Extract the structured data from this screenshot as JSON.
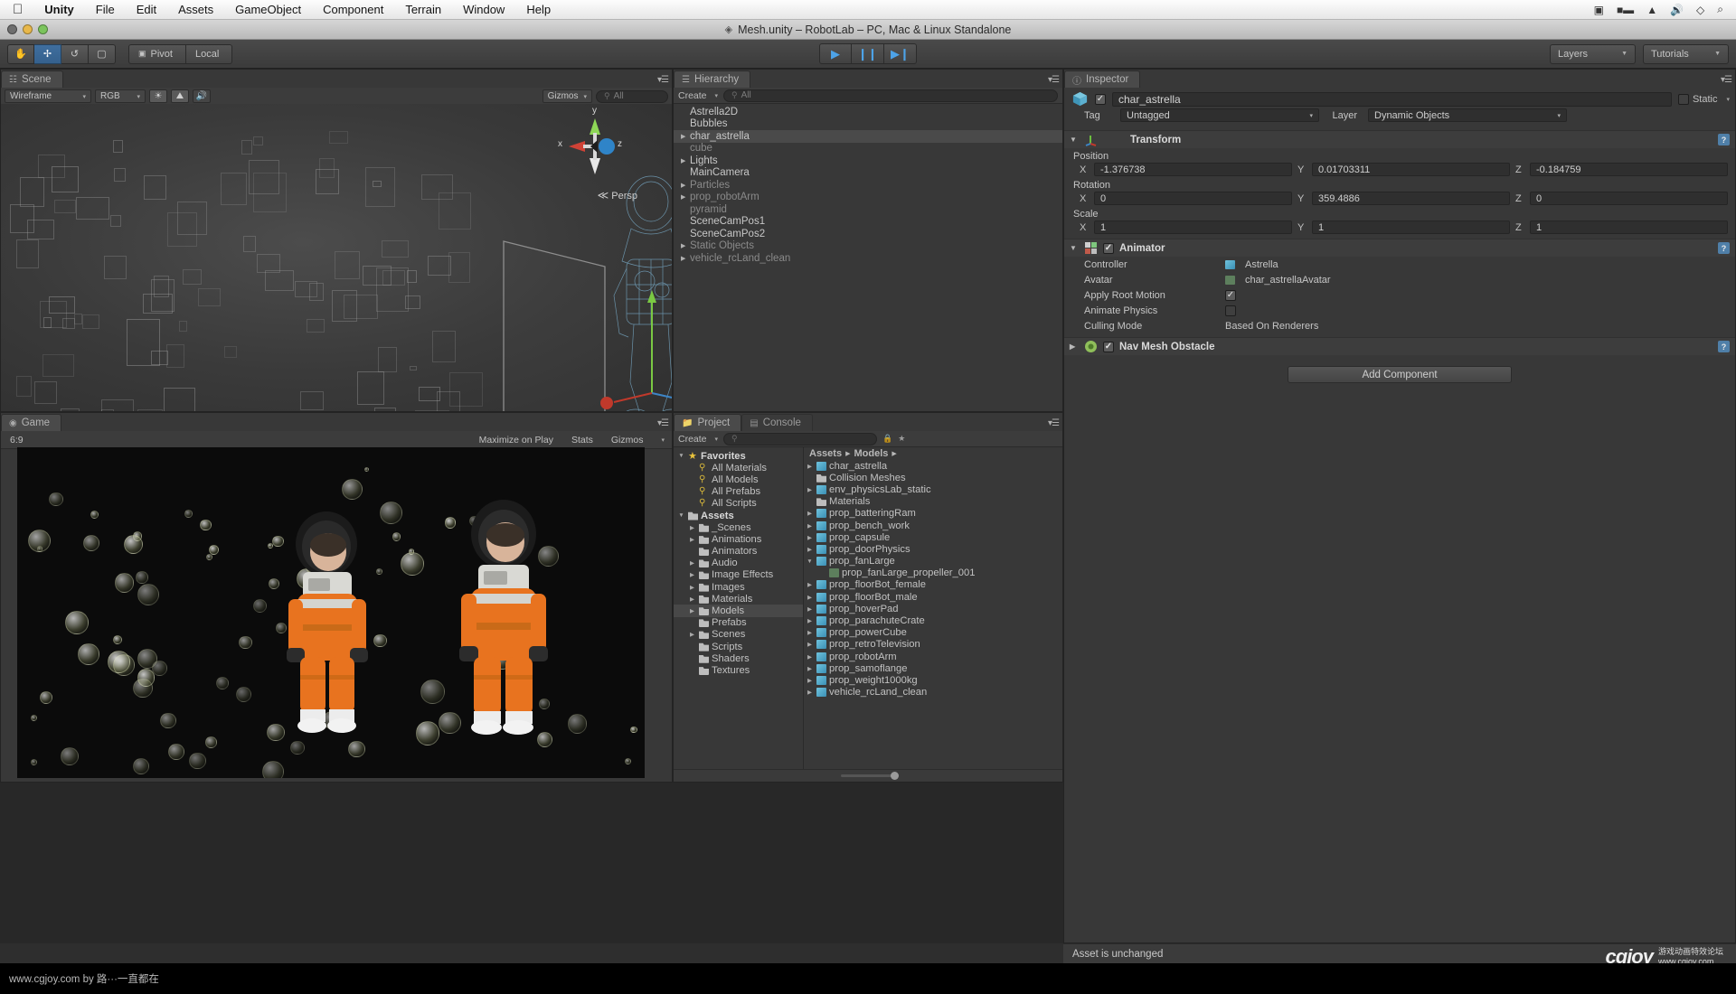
{
  "os_menu": {
    "apple_icon": "apple-icon",
    "items": [
      "Unity",
      "File",
      "Edit",
      "Assets",
      "GameObject",
      "Component",
      "Terrain",
      "Window",
      "Help"
    ],
    "status_icons": [
      "screen-record-icon",
      "battery-icon",
      "wifi-icon",
      "volume-icon",
      "bluetooth-icon",
      "search-icon"
    ]
  },
  "window": {
    "title": "Mesh.unity – RobotLab – PC, Mac & Linux Standalone",
    "title_icon": "unity-icon"
  },
  "toolbar": {
    "tools": [
      "hand-tool",
      "move-tool",
      "rotate-tool",
      "scale-tool"
    ],
    "active_tool_index": 1,
    "pivot_label": "Pivot",
    "space_label": "Local",
    "play_buttons": [
      "play-icon",
      "pause-icon",
      "step-icon"
    ],
    "layers_label": "Layers",
    "layout_label": "Tutorials"
  },
  "scene": {
    "tab_label": "Scene",
    "draw_mode": "Wireframe",
    "color_mode": "RGB",
    "toggles": [
      "lighting-icon",
      "skybox-icon",
      "audio-icon"
    ],
    "gizmos_label": "Gizmos",
    "search_placeholder": "All",
    "axis_labels": {
      "x": "x",
      "y": "y",
      "z": "z"
    },
    "projection": "Persp"
  },
  "game": {
    "tab_label": "Game",
    "aspect": "6:9",
    "maximize_label": "Maximize on Play",
    "stats_label": "Stats",
    "gizmos_label": "Gizmos"
  },
  "hierarchy": {
    "tab_label": "Hierarchy",
    "create_label": "Create",
    "search_placeholder": "All",
    "items": [
      {
        "label": "Astrella2D",
        "expandable": false,
        "selected": false,
        "dim": false
      },
      {
        "label": "Bubbles",
        "expandable": false,
        "selected": false,
        "dim": false
      },
      {
        "label": "char_astrella",
        "expandable": true,
        "selected": true,
        "dim": false
      },
      {
        "label": "cube",
        "expandable": false,
        "selected": false,
        "dim": true
      },
      {
        "label": "Lights",
        "expandable": true,
        "selected": false,
        "dim": false
      },
      {
        "label": "MainCamera",
        "expandable": false,
        "selected": false,
        "dim": false
      },
      {
        "label": "Particles",
        "expandable": true,
        "selected": false,
        "dim": true
      },
      {
        "label": "prop_robotArm",
        "expandable": true,
        "selected": false,
        "dim": true
      },
      {
        "label": "pyramid",
        "expandable": false,
        "selected": false,
        "dim": true
      },
      {
        "label": "SceneCamPos1",
        "expandable": false,
        "selected": false,
        "dim": false
      },
      {
        "label": "SceneCamPos2",
        "expandable": false,
        "selected": false,
        "dim": false
      },
      {
        "label": "Static Objects",
        "expandable": true,
        "selected": false,
        "dim": true
      },
      {
        "label": "vehicle_rcLand_clean",
        "expandable": true,
        "selected": false,
        "dim": true
      }
    ]
  },
  "inspector": {
    "tab_label": "Inspector",
    "object_name": "char_astrella",
    "object_enabled": true,
    "static_label": "Static",
    "tag_label": "Tag",
    "tag_value": "Untagged",
    "layer_label": "Layer",
    "layer_value": "Dynamic Objects",
    "transform": {
      "title": "Transform",
      "position_label": "Position",
      "rotation_label": "Rotation",
      "scale_label": "Scale",
      "position": {
        "x": "-1.376738",
        "y": "0.01703311",
        "z": "-0.184759"
      },
      "rotation": {
        "x": "0",
        "y": "359.4886",
        "z": "0"
      },
      "scale": {
        "x": "1",
        "y": "1",
        "z": "1"
      },
      "axis": {
        "x": "X",
        "y": "Y",
        "z": "Z"
      }
    },
    "animator": {
      "title": "Animator",
      "enabled": true,
      "rows": [
        {
          "label": "Controller",
          "value": "Astrella",
          "icon": "controller-icon",
          "type": "object"
        },
        {
          "label": "Avatar",
          "value": "char_astrellaAvatar",
          "icon": "avatar-icon",
          "type": "object"
        },
        {
          "label": "Apply Root Motion",
          "value": "",
          "type": "checkbox",
          "checked": true
        },
        {
          "label": "Animate Physics",
          "value": "",
          "type": "checkbox",
          "checked": false
        },
        {
          "label": "Culling Mode",
          "value": "Based On Renderers",
          "type": "enum"
        }
      ]
    },
    "nav_mesh_obstacle": {
      "title": "Nav Mesh Obstacle",
      "enabled": true
    },
    "add_component_label": "Add Component"
  },
  "project": {
    "tab_label": "Project",
    "console_tab_label": "Console",
    "create_label": "Create",
    "search_placeholder": "",
    "tree": [
      {
        "label": "Favorites",
        "icon": "star-icon",
        "indent": 0,
        "arrow": "down",
        "selected": false
      },
      {
        "label": "All Materials",
        "icon": "search-icon",
        "indent": 1,
        "arrow": "none",
        "selected": false
      },
      {
        "label": "All Models",
        "icon": "search-icon",
        "indent": 1,
        "arrow": "none",
        "selected": false
      },
      {
        "label": "All Prefabs",
        "icon": "search-icon",
        "indent": 1,
        "arrow": "none",
        "selected": false
      },
      {
        "label": "All Scripts",
        "icon": "search-icon",
        "indent": 1,
        "arrow": "none",
        "selected": false
      },
      {
        "label": "Assets",
        "icon": "folder-icon",
        "indent": 0,
        "arrow": "down",
        "selected": false
      },
      {
        "label": "_Scenes",
        "icon": "folder-icon",
        "indent": 1,
        "arrow": "right",
        "selected": false
      },
      {
        "label": "Animations",
        "icon": "folder-icon",
        "indent": 1,
        "arrow": "right",
        "selected": false
      },
      {
        "label": "Animators",
        "icon": "folder-icon",
        "indent": 1,
        "arrow": "none",
        "selected": false
      },
      {
        "label": "Audio",
        "icon": "folder-icon",
        "indent": 1,
        "arrow": "right",
        "selected": false
      },
      {
        "label": "Image Effects",
        "icon": "folder-icon",
        "indent": 1,
        "arrow": "right",
        "selected": false
      },
      {
        "label": "Images",
        "icon": "folder-icon",
        "indent": 1,
        "arrow": "right",
        "selected": false
      },
      {
        "label": "Materials",
        "icon": "folder-icon",
        "indent": 1,
        "arrow": "right",
        "selected": false
      },
      {
        "label": "Models",
        "icon": "folder-icon",
        "indent": 1,
        "arrow": "right",
        "selected": true
      },
      {
        "label": "Prefabs",
        "icon": "folder-icon",
        "indent": 1,
        "arrow": "none",
        "selected": false
      },
      {
        "label": "Scenes",
        "icon": "folder-icon",
        "indent": 1,
        "arrow": "right",
        "selected": false
      },
      {
        "label": "Scripts",
        "icon": "folder-icon",
        "indent": 1,
        "arrow": "none",
        "selected": false
      },
      {
        "label": "Shaders",
        "icon": "folder-icon",
        "indent": 1,
        "arrow": "none",
        "selected": false
      },
      {
        "label": "Textures",
        "icon": "folder-icon",
        "indent": 1,
        "arrow": "none",
        "selected": false
      }
    ],
    "breadcrumb": [
      "Assets",
      "Models"
    ],
    "assets": [
      {
        "label": "char_astrella",
        "icon": "mesh-icon",
        "indent": 0,
        "arrow": "right"
      },
      {
        "label": "Collision Meshes",
        "icon": "folder-icon",
        "indent": 0,
        "arrow": "none"
      },
      {
        "label": "env_physicsLab_static",
        "icon": "mesh-icon",
        "indent": 0,
        "arrow": "right"
      },
      {
        "label": "Materials",
        "icon": "folder-icon",
        "indent": 0,
        "arrow": "none"
      },
      {
        "label": "prop_batteringRam",
        "icon": "mesh-icon",
        "indent": 0,
        "arrow": "right"
      },
      {
        "label": "prop_bench_work",
        "icon": "mesh-icon",
        "indent": 0,
        "arrow": "right"
      },
      {
        "label": "prop_capsule",
        "icon": "mesh-icon",
        "indent": 0,
        "arrow": "right"
      },
      {
        "label": "prop_doorPhysics",
        "icon": "mesh-icon",
        "indent": 0,
        "arrow": "right"
      },
      {
        "label": "prop_fanLarge",
        "icon": "mesh-icon",
        "indent": 0,
        "arrow": "down"
      },
      {
        "label": "prop_fanLarge_propeller_001",
        "icon": "grid-icon",
        "indent": 1,
        "arrow": "none"
      },
      {
        "label": "prop_floorBot_female",
        "icon": "mesh-icon",
        "indent": 0,
        "arrow": "right"
      },
      {
        "label": "prop_floorBot_male",
        "icon": "mesh-icon",
        "indent": 0,
        "arrow": "right"
      },
      {
        "label": "prop_hoverPad",
        "icon": "mesh-icon",
        "indent": 0,
        "arrow": "right"
      },
      {
        "label": "prop_parachuteCrate",
        "icon": "mesh-icon",
        "indent": 0,
        "arrow": "right"
      },
      {
        "label": "prop_powerCube",
        "icon": "mesh-icon",
        "indent": 0,
        "arrow": "right"
      },
      {
        "label": "prop_retroTelevision",
        "icon": "mesh-icon",
        "indent": 0,
        "arrow": "right"
      },
      {
        "label": "prop_robotArm",
        "icon": "mesh-icon",
        "indent": 0,
        "arrow": "right"
      },
      {
        "label": "prop_samoflange",
        "icon": "mesh-icon",
        "indent": 0,
        "arrow": "right"
      },
      {
        "label": "prop_weight1000kg",
        "icon": "mesh-icon",
        "indent": 0,
        "arrow": "right"
      },
      {
        "label": "vehicle_rcLand_clean",
        "icon": "mesh-icon",
        "indent": 0,
        "arrow": "right"
      }
    ]
  },
  "status_bar": {
    "message": "Asset is unchanged"
  },
  "watermark": {
    "logo_text": "cgjoy",
    "chinese": "游戏动画特效论坛",
    "url": "www.cgjoy.com"
  },
  "footer": {
    "text": "www.cgjoy.com by 路···一直都在"
  },
  "colors": {
    "accent_blue": "#4da3e8",
    "panel_bg": "#383838",
    "selection": "#4a4a4a",
    "axis_x": "#c0392b",
    "axis_y": "#7ac943",
    "axis_z": "#3d85c6"
  }
}
